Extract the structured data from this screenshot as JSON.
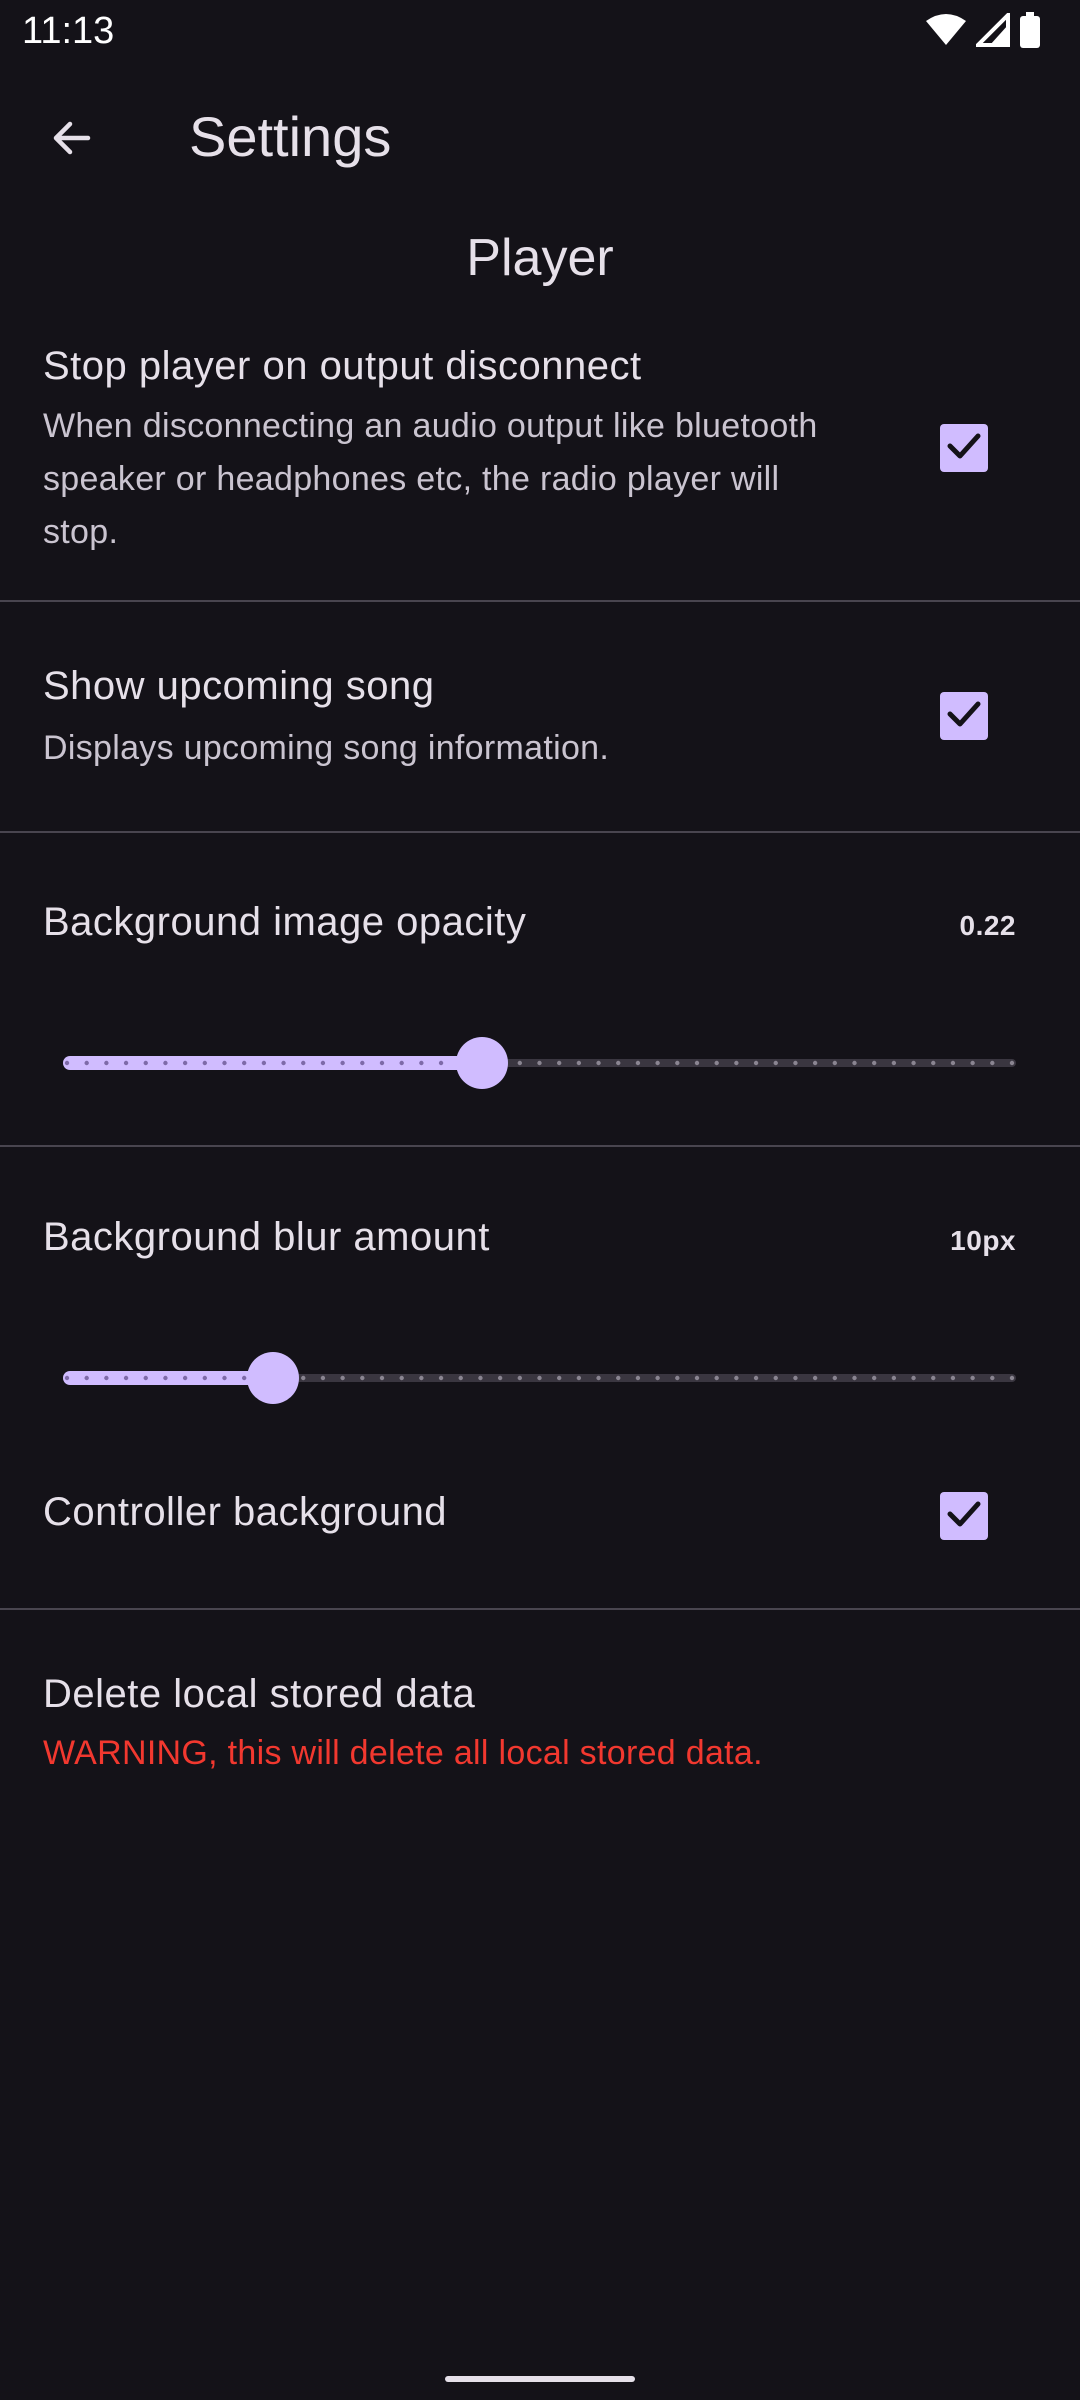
{
  "status_bar": {
    "time": "11:13",
    "icons": [
      "wifi-icon",
      "signal-icon",
      "battery-icon"
    ]
  },
  "app_bar": {
    "title": "Settings",
    "back_icon": "arrow-back-icon"
  },
  "section": {
    "title": "Player"
  },
  "settings": {
    "stop_on_disconnect": {
      "title": "Stop player on output disconnect",
      "subtitle": "When disconnecting an audio output like bluetooth speaker or headphones etc, the radio player will stop.",
      "checked": true
    },
    "upcoming_song": {
      "title": "Show upcoming song",
      "subtitle": "Displays upcoming song information.",
      "checked": true
    },
    "bg_opacity": {
      "title": "Background image opacity",
      "value_label": "0.22",
      "fraction": 0.44
    },
    "bg_blur": {
      "title": "Background blur amount",
      "value_label": "10px",
      "fraction": 0.22
    },
    "controller_bg": {
      "title": "Controller background",
      "checked": true
    },
    "delete_data": {
      "title": "Delete local stored data",
      "warning": "WARNING, this will delete all local stored data."
    }
  },
  "colors": {
    "accent": "#d0bcff",
    "background": "#141218",
    "danger": "#f2382f"
  }
}
